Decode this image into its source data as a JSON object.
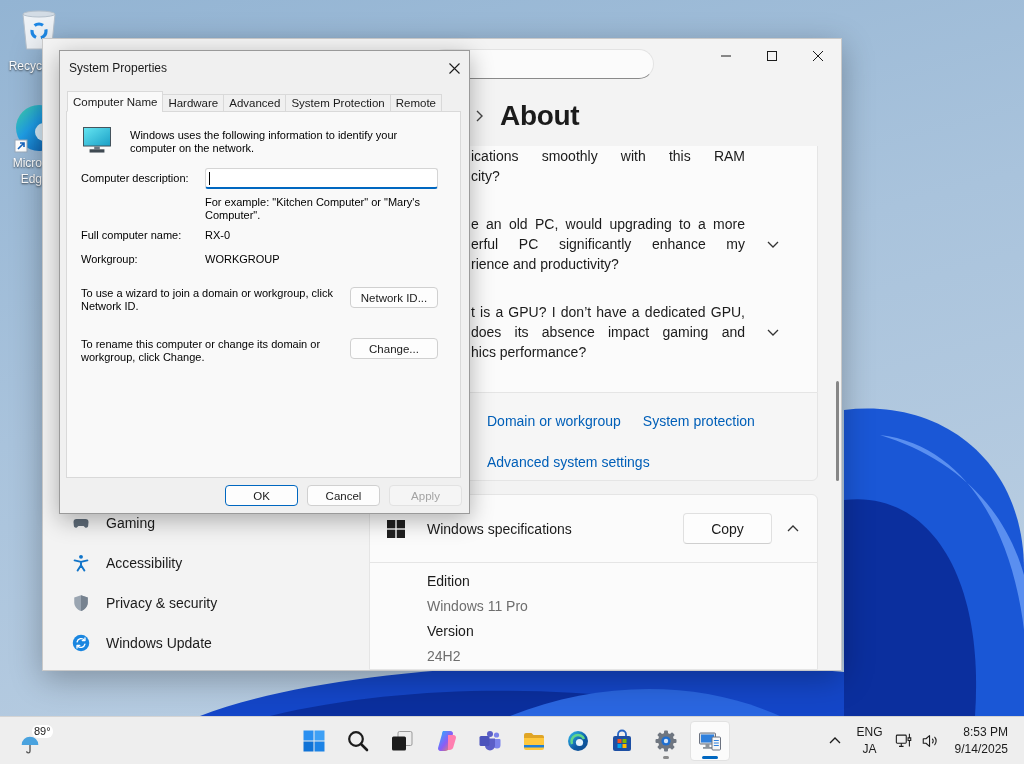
{
  "desktop_icons": [
    {
      "kind": "recycle-bin",
      "label_lines": [
        "Recyc"
      ]
    },
    {
      "kind": "edge",
      "label_lines": [
        "Micro",
        "Edg"
      ]
    }
  ],
  "settings_window": {
    "page_title": "About",
    "faq": [
      {
        "lines": [
          "ications smoothly with this RAM",
          "city?"
        ]
      },
      {
        "lines": [
          "e an old PC, would upgrading to a more",
          "erful PC significantly enhance my",
          "rience and productivity?"
        ],
        "expanded": false
      },
      {
        "lines": [
          "t is a GPU? I don’t have a dedicated GPU,",
          "does its absence impact gaming and",
          "hics performance?"
        ],
        "expanded": false
      }
    ],
    "related_links": [
      "Domain or workgroup",
      "System protection",
      "Advanced system settings"
    ],
    "specs": {
      "title": "Windows specifications",
      "copy_button": "Copy",
      "expanded": true,
      "rows": [
        {
          "label": "Edition",
          "value": "Windows 11 Pro"
        },
        {
          "label": "Version",
          "value": "24H2"
        }
      ]
    },
    "nav": [
      {
        "kind": "gaming",
        "label": "Gaming",
        "selected": false
      },
      {
        "kind": "accessibility",
        "label": "Accessibility",
        "selected": false
      },
      {
        "kind": "privacy",
        "label": "Privacy & security",
        "selected": false
      },
      {
        "kind": "update",
        "label": "Windows Update",
        "selected": false
      }
    ]
  },
  "dialog": {
    "title": "System Properties",
    "tabs": [
      {
        "label": "Computer Name",
        "selected": true
      },
      {
        "label": "Hardware",
        "selected": false
      },
      {
        "label": "Advanced",
        "selected": false
      },
      {
        "label": "System Protection",
        "selected": false
      },
      {
        "label": "Remote",
        "selected": false
      }
    ],
    "intro": "Windows uses the following information to identify your computer on the network.",
    "description_field": {
      "label": "Computer description:",
      "focused": true
    },
    "hint": "For example: \"Kitchen Computer\" or \"Mary's Computer\".",
    "info_rows": [
      {
        "label": "Full computer name:",
        "value": "RX-0"
      },
      {
        "label": "Workgroup:",
        "value": "WORKGROUP"
      }
    ],
    "actions": [
      {
        "text": "To use a wizard to join a domain or workgroup, click Network ID.",
        "button": "Network ID..."
      },
      {
        "text": "To rename this computer or change its domain or workgroup, click Change.",
        "button": "Change..."
      }
    ],
    "footer_buttons": [
      {
        "label": "OK",
        "default": true,
        "disabled": false
      },
      {
        "label": "Cancel",
        "default": false,
        "disabled": false
      },
      {
        "label": "Apply",
        "default": false,
        "disabled": true
      }
    ]
  },
  "taskbar": {
    "weather": {
      "temperature": "89°"
    },
    "apps": [
      {
        "kind": "start",
        "running": false,
        "selected": false
      },
      {
        "kind": "search",
        "running": false,
        "selected": false
      },
      {
        "kind": "task-view",
        "running": false,
        "selected": false
      },
      {
        "kind": "copilot",
        "running": false,
        "selected": false
      },
      {
        "kind": "teams",
        "running": false,
        "selected": false
      },
      {
        "kind": "file-explorer",
        "running": false,
        "selected": false
      },
      {
        "kind": "edge",
        "running": false,
        "selected": false
      },
      {
        "kind": "store",
        "running": false,
        "selected": false
      },
      {
        "kind": "settings",
        "running": true,
        "selected": false
      },
      {
        "kind": "system-properties",
        "running": true,
        "selected": true
      }
    ],
    "tray": {
      "input_language": "ENG",
      "keyboard_layout": "JA",
      "time": "8:53 PM",
      "date": "9/14/2025"
    }
  }
}
